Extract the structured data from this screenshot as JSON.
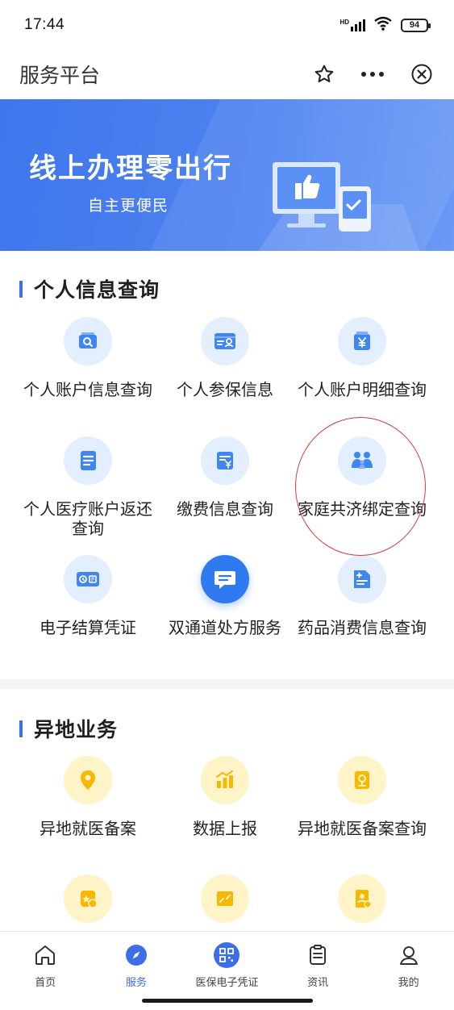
{
  "status_bar": {
    "time": "17:44",
    "network": "HD",
    "battery": "94"
  },
  "header": {
    "title": "服务平台"
  },
  "banner": {
    "title": "线上办理零出行",
    "subtitle": "自主更便民"
  },
  "personal_section": {
    "title": "个人信息查询",
    "items": [
      {
        "label": "个人账户信息查询",
        "icon": "account-search-icon"
      },
      {
        "label": "个人参保信息",
        "icon": "insurance-card-icon"
      },
      {
        "label": "个人账户明细查询",
        "icon": "yuan-detail-icon"
      },
      {
        "label": "个人医疗账户返还查询",
        "icon": "document-list-icon"
      },
      {
        "label": "缴费信息查询",
        "icon": "payment-icon"
      },
      {
        "label": "家庭共济绑定查询",
        "icon": "family-icon"
      },
      {
        "label": "电子结算凭证",
        "icon": "settlement-voucher-icon"
      },
      {
        "label": "双通道处方服务",
        "icon": "prescription-message-icon"
      },
      {
        "label": "药品消费信息查询",
        "icon": "drug-consumption-icon"
      }
    ]
  },
  "remote_section": {
    "title": "异地业务",
    "items": [
      {
        "label": "异地就医备案",
        "icon": "location-pin-icon"
      },
      {
        "label": "数据上报",
        "icon": "bar-chart-icon"
      },
      {
        "label": "异地就医备案查询",
        "icon": "record-search-icon"
      }
    ]
  },
  "bottom_nav": {
    "items": [
      {
        "label": "首页",
        "icon": "home-icon"
      },
      {
        "label": "服务",
        "icon": "compass-icon"
      },
      {
        "label": "医保电子凭证",
        "icon": "qr-code-icon"
      },
      {
        "label": "资讯",
        "icon": "clipboard-icon"
      },
      {
        "label": "我的",
        "icon": "person-icon"
      }
    ],
    "active": "服务"
  },
  "colors": {
    "primary": "#3b6ee8",
    "banner": "#4d82f0",
    "annotation": "#d83a3a",
    "accent_yellow": "#f6b800"
  }
}
